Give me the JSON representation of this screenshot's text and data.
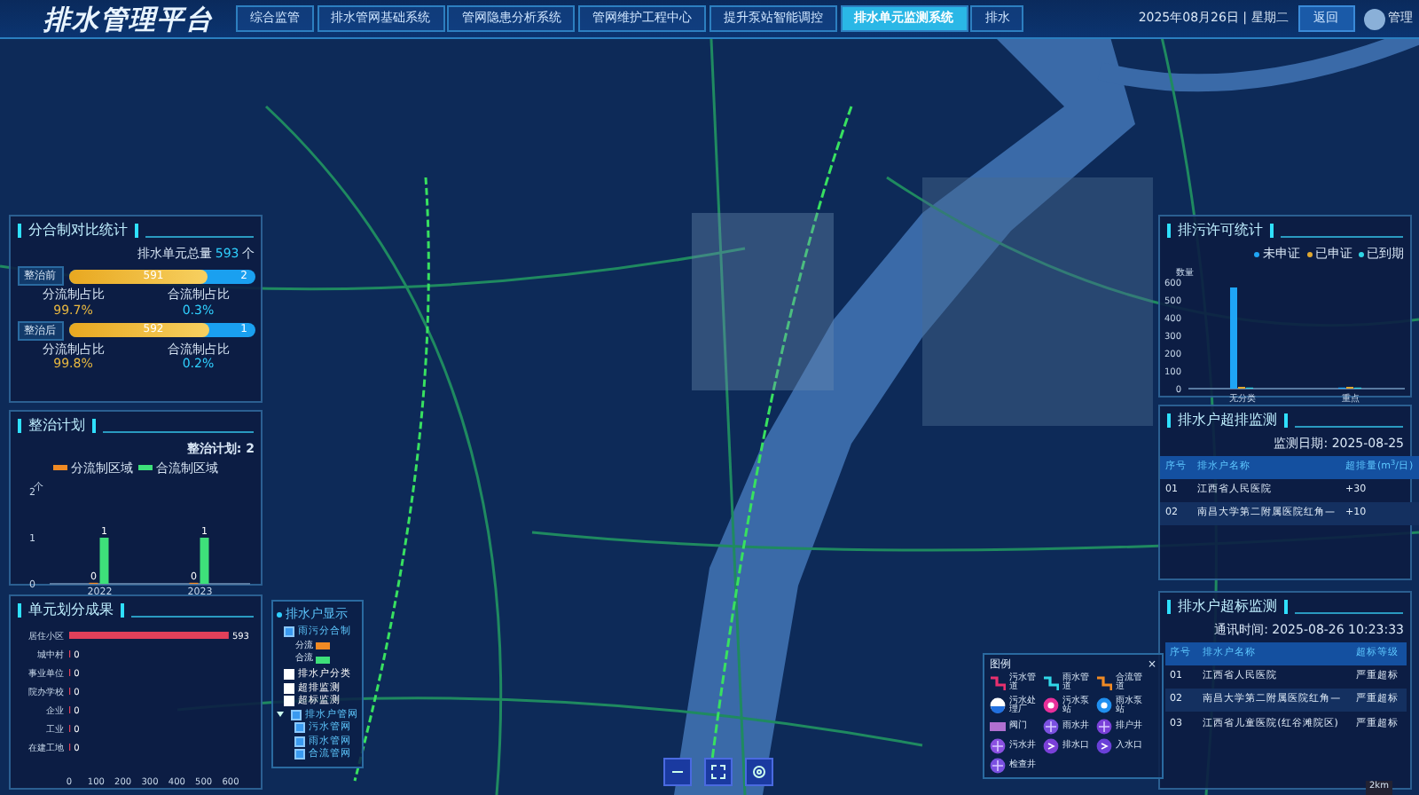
{
  "header": {
    "title": "排水管理平台",
    "tabs": [
      {
        "label": "综合监管",
        "selected": false
      },
      {
        "label": "排水管网基础系统",
        "selected": false
      },
      {
        "label": "管网隐患分析系统",
        "selected": false
      },
      {
        "label": "管网维护工程中心",
        "selected": false
      },
      {
        "label": "提升泵站智能调控",
        "selected": false
      },
      {
        "label": "排水单元监测系统",
        "selected": true
      },
      {
        "label": "排水",
        "selected": false
      }
    ],
    "date": "2025年08月26日 | 星期二",
    "back_button": "返回",
    "user": "管理"
  },
  "comparison": {
    "title": "分合制对比统计",
    "total_label": "排水单元总量",
    "total": "593",
    "unit": "个",
    "groups": [
      {
        "label": "整治前",
        "split_value": "591",
        "combined_value": "2",
        "level": 0.75,
        "split_label": "分流制占比",
        "split_pct": "99.7%",
        "combined_label": "合流制占比",
        "combined_pct": "0.3%"
      },
      {
        "label": "整治后",
        "split_value": "592",
        "combined_value": "1",
        "level": 0.76,
        "split_label": "分流制占比",
        "split_pct": "99.8%",
        "combined_label": "合流制占比",
        "combined_pct": "0.2%"
      }
    ]
  },
  "plan": {
    "title": "整治计划",
    "summary": "整治计划: 2",
    "chart_data": {
      "type": "bar",
      "ylabel": "个",
      "categories": [
        "2022",
        "2023"
      ],
      "ylim": [
        0,
        2
      ],
      "yticks": [
        0,
        1,
        2
      ],
      "data_labels": true,
      "series": [
        {
          "name": "分流制区域",
          "color": "#f08a24",
          "values": [
            0,
            0
          ]
        },
        {
          "name": "合流制区域",
          "color": "#3ee07a",
          "values": [
            1,
            1
          ]
        }
      ]
    }
  },
  "division": {
    "title": "单元划分成果",
    "chart_data": {
      "type": "bar",
      "orientation": "horizontal",
      "categories": [
        "居住小区",
        "城中村",
        "事业单位",
        "院办学校",
        "企业",
        "工业",
        "在建工地"
      ],
      "xlim": [
        0,
        600
      ],
      "xticks": [
        0,
        100,
        200,
        300,
        400,
        500,
        600
      ],
      "data_labels": true,
      "series": [
        {
          "color": "#e0405a",
          "values": [
            593,
            0,
            0,
            0,
            0,
            0,
            0
          ]
        }
      ]
    }
  },
  "permit": {
    "title": "排污许可统计",
    "chart_data": {
      "type": "bar",
      "ylabel": "数量",
      "categories": [
        "无分类",
        "重点"
      ],
      "ylim": [
        0,
        600
      ],
      "yticks": [
        0,
        100,
        200,
        300,
        400,
        500,
        600
      ],
      "series": [
        {
          "name": "未申证",
          "color": "#1fa5f5",
          "values": [
            570,
            0
          ]
        },
        {
          "name": "已申证",
          "color": "#e0a830",
          "values": [
            10,
            10
          ]
        },
        {
          "name": "已到期",
          "color": "#2fd6e6",
          "values": [
            0,
            0
          ]
        }
      ]
    }
  },
  "overflow": {
    "title": "排水户超排监测",
    "date": "监测日期: 2025-08-25",
    "columns": [
      "序号",
      "排水户名称",
      "超排量(m$^{3}$/日)"
    ],
    "rows": [
      [
        "01",
        "江西省人民医院",
        "+30"
      ],
      [
        "02",
        "南昌大学第二附属医院红角—",
        "+10"
      ]
    ]
  },
  "exceed": {
    "title": "排水户超标监测",
    "date": "通讯时间: 2025-08-26 10:23:33",
    "columns": [
      "序号",
      "排水户名称",
      "超标等级"
    ],
    "rows": [
      [
        "01",
        "江西省人民医院",
        "严重超标"
      ],
      [
        "02",
        "南昌大学第二附属医院红角—",
        "严重超标"
      ],
      [
        "03",
        "江西省儿童医院(红谷滩院区)",
        "严重超标"
      ]
    ]
  },
  "layers": {
    "title": "排水户显示",
    "items": [
      {
        "label": "雨污分合制",
        "checked": true,
        "legend": [
          {
            "label": "分流",
            "color": "#f08a24"
          },
          {
            "label": "合流",
            "color": "#3ee07a"
          }
        ]
      },
      {
        "label": "排水户分类",
        "checked": false
      },
      {
        "label": "超排监测",
        "checked": false
      },
      {
        "label": "超标监测",
        "checked": false
      },
      {
        "label": "排水户管网",
        "checked": true,
        "expanded": true,
        "children": [
          {
            "label": "污水管网",
            "checked": true
          },
          {
            "label": "雨水管网",
            "checked": true
          },
          {
            "label": "合流管网",
            "checked": true
          }
        ]
      }
    ]
  },
  "legend": {
    "title": "图例",
    "close": "×",
    "items": [
      {
        "label": "污水管道",
        "kind": "pipe",
        "color": "#e8306e"
      },
      {
        "label": "雨水管道",
        "kind": "pipe",
        "color": "#30d8e8"
      },
      {
        "label": "合流管道",
        "kind": "pipe",
        "color": "#f08a24"
      },
      {
        "label": "污水处理厂",
        "kind": "plant",
        "color": "#2070e0"
      },
      {
        "label": "污水泵站",
        "kind": "station",
        "color": "#e8309a"
      },
      {
        "label": "雨水泵站",
        "kind": "station",
        "color": "#2090f0"
      },
      {
        "label": "阀门",
        "kind": "valve",
        "color": "#b070d0"
      },
      {
        "label": "雨水井",
        "kind": "well",
        "color": "#7a50e0"
      },
      {
        "label": "排户井",
        "kind": "well",
        "color": "#7a40d8"
      },
      {
        "label": "污水井",
        "kind": "well",
        "color": "#8a50e0"
      },
      {
        "label": "排水口",
        "kind": "outlet",
        "color": "#7a40d8"
      },
      {
        "label": "入水口",
        "kind": "outlet",
        "color": "#6a40d8"
      },
      {
        "label": "检查井",
        "kind": "well",
        "color": "#7a50e0"
      }
    ]
  },
  "scale": "2km"
}
